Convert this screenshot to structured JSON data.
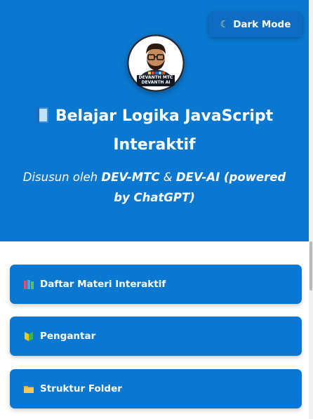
{
  "header": {
    "dark_mode_label": "Dark Mode",
    "title": "Belajar Logika JavaScript Interaktif",
    "subtitle_prefix": "Disusun oleh ",
    "author1": "DEV-MTC",
    "subtitle_and": " & ",
    "author2": "DEV-AI (powered by ChatGPT)",
    "avatar_text_line1": "DEVANTH MTC",
    "avatar_text_line2": "DEVANTH AI"
  },
  "menu": [
    {
      "label": "Daftar Materi Interaktif",
      "icon": "books-icon"
    },
    {
      "label": "Pengantar",
      "icon": "beginner-icon"
    },
    {
      "label": "Struktur Folder",
      "icon": "folder-icon"
    }
  ],
  "colors": {
    "primary": "#0a78d1",
    "white": "#ffffff"
  }
}
